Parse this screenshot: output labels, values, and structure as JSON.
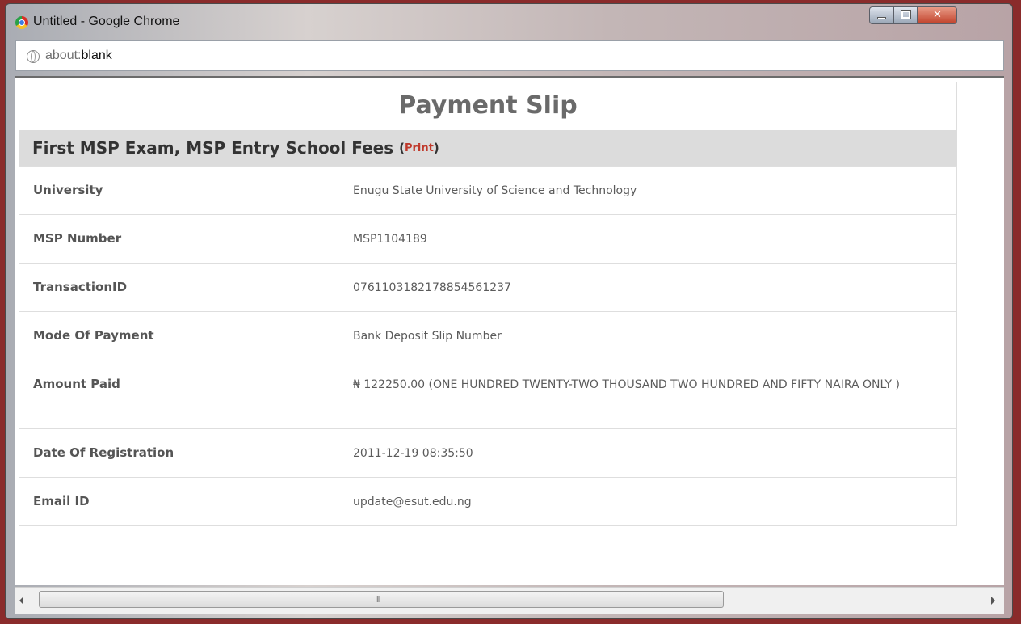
{
  "window": {
    "title": "Untitled - Google Chrome"
  },
  "addressbar": {
    "scheme": "about:",
    "host": "blank"
  },
  "slip": {
    "title": "Payment Slip",
    "section_title": "First MSP Exam, MSP Entry School Fees",
    "print_label": "Print",
    "rows": [
      {
        "label": "University",
        "value": "Enugu State University of Science and Technology"
      },
      {
        "label": "MSP Number",
        "value": "MSP1104189"
      },
      {
        "label": "TransactionID",
        "value": "0761103182178854561237"
      },
      {
        "label": "Mode Of Payment",
        "value": "Bank Deposit Slip Number"
      },
      {
        "label": "Amount Paid",
        "value": "₦ 122250.00 (ONE HUNDRED TWENTY-TWO THOUSAND TWO HUNDRED AND FIFTY NAIRA ONLY )"
      },
      {
        "label": "Date Of Registration",
        "value": "2011-12-19 08:35:50"
      },
      {
        "label": "Email ID",
        "value": "update@esut.edu.ng"
      }
    ]
  },
  "scrollbar": {
    "grip": "III"
  }
}
